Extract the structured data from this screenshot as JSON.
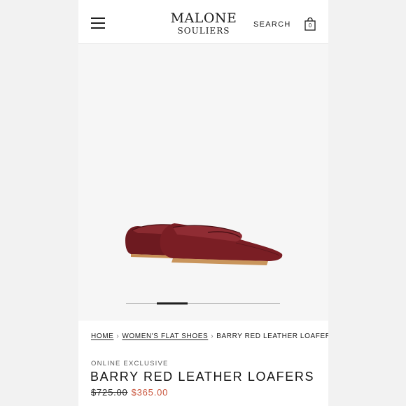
{
  "header": {
    "brand_line1": "MALONE",
    "brand_line2": "SOULIERS",
    "search_label": "SEARCH",
    "bag_count": "0"
  },
  "gallery": {
    "active_slide": 2,
    "slide_count": 5
  },
  "breadcrumb": {
    "home": "HOME",
    "category": "WOMEN'S FLAT SHOES",
    "current": "BARRY RED LEATHER LOAFERS",
    "separator": "›"
  },
  "product": {
    "badge": "ONLINE EXCLUSIVE",
    "title": "BARRY RED LEATHER LOAFERS",
    "original_price": "$725.00",
    "sale_price": "$365.00"
  },
  "colors": {
    "sale_price": "#c9553c",
    "leather": "#7a1e24"
  }
}
